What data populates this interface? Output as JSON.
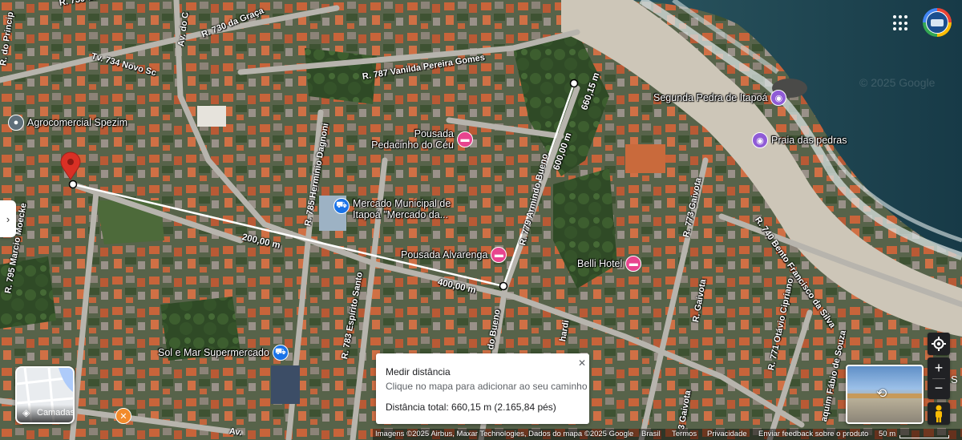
{
  "colors": {
    "accent": "#d93025",
    "lodging": "#e8448e",
    "shopping": "#1a73e8",
    "food": "#f28b2c",
    "place": "#8f5bd6",
    "measure_line": "#ffffff"
  },
  "streets": [
    "R. 730 da Graça",
    "R. 730 da Graça",
    "Tv. 734 Novo Sc",
    "R. 787 Vanilda Pereira Gomes",
    "R. do Princip",
    "Av. do C",
    "R. 785 Hermínio Dagnoni",
    "R. 779 Armindo Bueno",
    "R. 773 Gaivota",
    "R. Gaivota",
    "R. 740 Bento Francisco da Silva",
    "R. 795 Marcio Moecke",
    "R. 783 Espírito Santo",
    "do Bueno",
    "hardi",
    "R. 771 Otávio Cipriano",
    "aquim Fábio de Souza",
    "3 Gaivota",
    "Av."
  ],
  "pois": [
    {
      "name": "Agrocomercial Spezim",
      "icon": "pin-icon"
    },
    {
      "name": "Pousada Pedacinho do Céu",
      "icon": "bed-icon"
    },
    {
      "name": "Mercado Municipal de Itapoá \"Mercado da...",
      "icon": "cart-icon"
    },
    {
      "name": "Pousada Alvarenga",
      "icon": "bed-icon"
    },
    {
      "name": "Belli Hotel",
      "icon": "bed-icon"
    },
    {
      "name": "Segunda Pedra de Itapoá",
      "icon": "camera-icon"
    },
    {
      "name": "Praia das pedras",
      "icon": "camera-icon"
    },
    {
      "name": "Sol e Mar Supermercado",
      "icon": "cart-icon"
    }
  ],
  "measurements": [
    "200,00 m",
    "400,00 m",
    "600,00 m",
    "660,15 m"
  ],
  "layers_button": {
    "label": "Camadas"
  },
  "measure_panel": {
    "title": "Medir distância",
    "hint": "Clique no mapa para adicionar ao seu caminho",
    "total": "Distância total: 660,15 m (2.165,84 pés)",
    "close": "✕"
  },
  "attribution": {
    "imagery": "Imagens ©2025 Airbus, Maxar Technologies, Dados do mapa ©2025 Google",
    "country": "Brasil",
    "terms": "Termos",
    "privacy": "Privacidade",
    "feedback": "Enviar feedback sobre o produto",
    "scale": "50 m"
  },
  "watermark": "© 2025 Google",
  "partial_label": "S"
}
